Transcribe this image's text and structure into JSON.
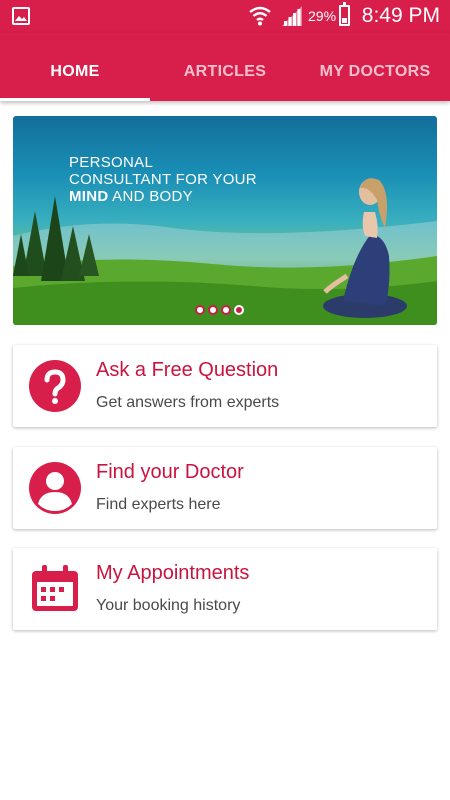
{
  "status_bar": {
    "battery_percent": "29%",
    "time": "8:49 PM"
  },
  "tabs": [
    {
      "label": "HOME",
      "active": true
    },
    {
      "label": "ARTICLES",
      "active": false
    },
    {
      "label": "MY DOCTORS",
      "active": false
    }
  ],
  "banner": {
    "line1": "PERSONAL",
    "line2": "CONSULTANT FOR YOUR",
    "line3_bold": "MIND",
    "line3_rest": " AND BODY",
    "slides_total": 4,
    "slide_active": 4
  },
  "cards": [
    {
      "title": "Ask a Free Question",
      "subtitle": "Get answers from experts"
    },
    {
      "title": "Find your Doctor",
      "subtitle": "Find experts here"
    },
    {
      "title": "My Appointments",
      "subtitle": "Your booking history"
    }
  ],
  "colors": {
    "primary": "#d81e4b",
    "accent": "#c8143f"
  }
}
